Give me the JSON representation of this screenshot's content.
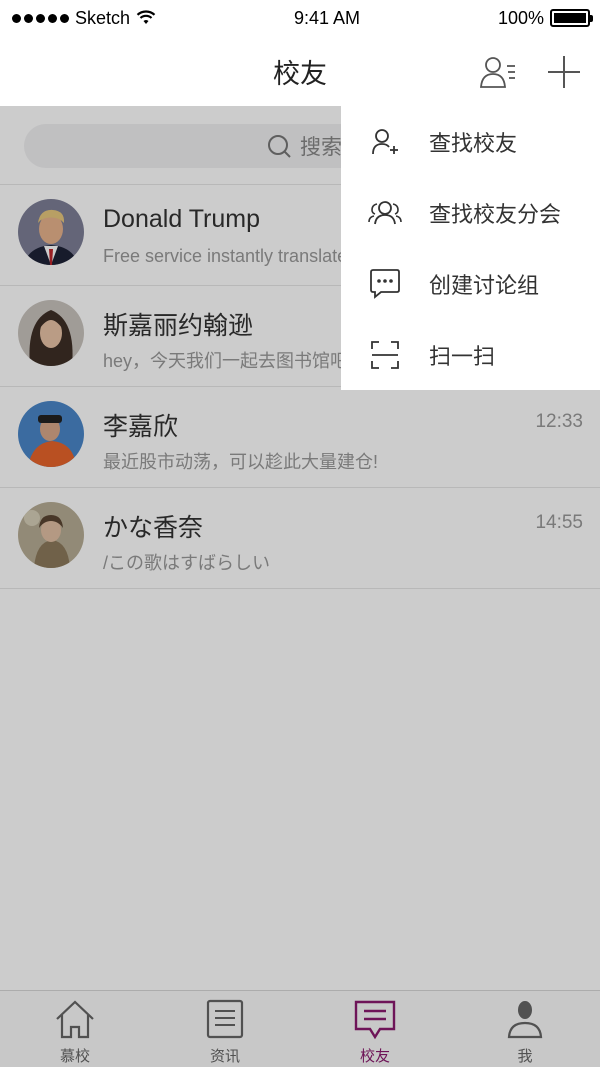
{
  "status_bar": {
    "carrier": "Sketch",
    "time": "9:41 AM",
    "battery": "100%"
  },
  "nav": {
    "title": "校友",
    "contacts_icon": "contacts-list-icon",
    "add_icon": "plus-icon"
  },
  "search": {
    "placeholder": "搜索"
  },
  "chats": [
    {
      "name": "Donald Trump",
      "message": "Free service instantly translates words, phrases",
      "time": "",
      "avatar": "avatar-donald-trump"
    },
    {
      "name": "斯嘉丽约翰逊",
      "message": "hey，今天我们一起去图书馆吧",
      "time": "",
      "avatar": "avatar-scarlett"
    },
    {
      "name": "李嘉欣",
      "message": "最近股市动荡，可以趁此大量建仓!",
      "time": "12:33",
      "avatar": "avatar-li-jiaxin"
    },
    {
      "name": "かな香奈",
      "message": "/この歌はすばらしい",
      "time": "14:55",
      "avatar": "avatar-kana"
    }
  ],
  "menu": [
    {
      "label": "查找校友",
      "icon": "add-person-icon"
    },
    {
      "label": "查找校友分会",
      "icon": "group-icon"
    },
    {
      "label": "创建讨论组",
      "icon": "chat-bubble-icon"
    },
    {
      "label": "扫一扫",
      "icon": "scan-icon"
    }
  ],
  "tabs": [
    {
      "label": "慕校",
      "icon": "home-icon",
      "active": false
    },
    {
      "label": "资讯",
      "icon": "news-icon",
      "active": false
    },
    {
      "label": "校友",
      "icon": "message-icon",
      "active": true
    },
    {
      "label": "我",
      "icon": "profile-icon",
      "active": false
    }
  ],
  "colors": {
    "accent": "#8a1a6e",
    "overlay": "rgba(0,0,0,0.2)"
  }
}
